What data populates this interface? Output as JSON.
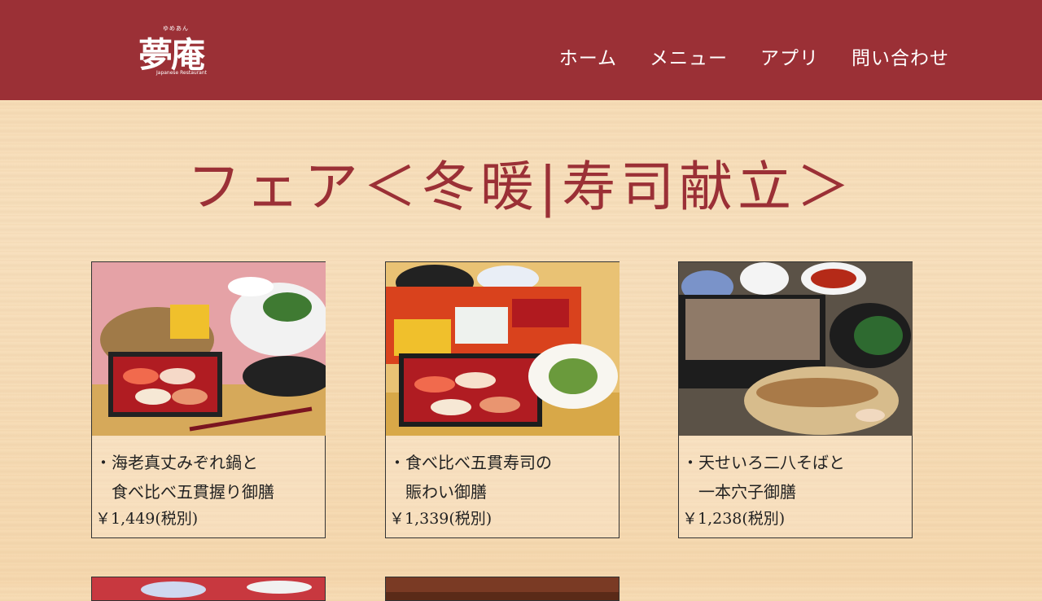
{
  "header": {
    "logo": {
      "ruby": "ゆめあん",
      "main": "夢庵",
      "sub": "Japanese Restaurant"
    },
    "nav": [
      "ホーム",
      "メニュー",
      "アプリ",
      "問い合わせ"
    ]
  },
  "page": {
    "title": "フェア＜冬暖|寿司献立＞"
  },
  "cards": [
    {
      "name": "・海老真丈みぞれ鍋と\n　食べ比べ五貫握り御膳",
      "price": "￥1,449(税別)"
    },
    {
      "name": "・食べ比べ五貫寿司の\n　賑わい御膳",
      "price": "￥1,339(税別)"
    },
    {
      "name": "・天せいろ二八そばと\n　一本穴子御膳",
      "price": "￥1,238(税別)"
    }
  ],
  "colors": {
    "header": "#9b3036",
    "title": "#9b3036"
  }
}
